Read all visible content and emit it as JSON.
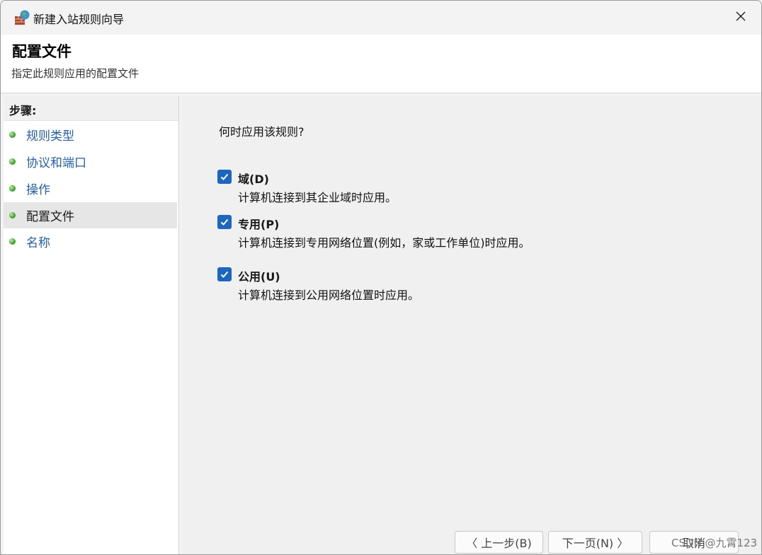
{
  "window": {
    "title": "新建入站规则向导",
    "close_glyph": "✕"
  },
  "header": {
    "title": "配置文件",
    "subtitle": "指定此规则应用的配置文件"
  },
  "steps": {
    "heading": "步骤:",
    "items": [
      {
        "label": "规则类型",
        "active": false
      },
      {
        "label": "协议和端口",
        "active": false
      },
      {
        "label": "操作",
        "active": false
      },
      {
        "label": "配置文件",
        "active": true
      },
      {
        "label": "名称",
        "active": false
      }
    ]
  },
  "main": {
    "question": "何时应用该规则?",
    "options": [
      {
        "label": "域(D)",
        "description": "计算机连接到其企业域时应用。",
        "checked": true
      },
      {
        "label": "专用(P)",
        "description": "计算机连接到专用网络位置(例如，家或工作单位)时应用。",
        "checked": true
      },
      {
        "label": "公用(U)",
        "description": "计算机连接到公用网络位置时应用。",
        "checked": true
      }
    ]
  },
  "buttons": {
    "back": "〈 上一步(B)",
    "next": "下一页(N) 〉",
    "cancel": "取消"
  },
  "watermark": "CSDN @九霄123",
  "colors": {
    "accent": "#1d65c4",
    "link": "#1f5fc2",
    "step_dot": "#3aa52a"
  }
}
